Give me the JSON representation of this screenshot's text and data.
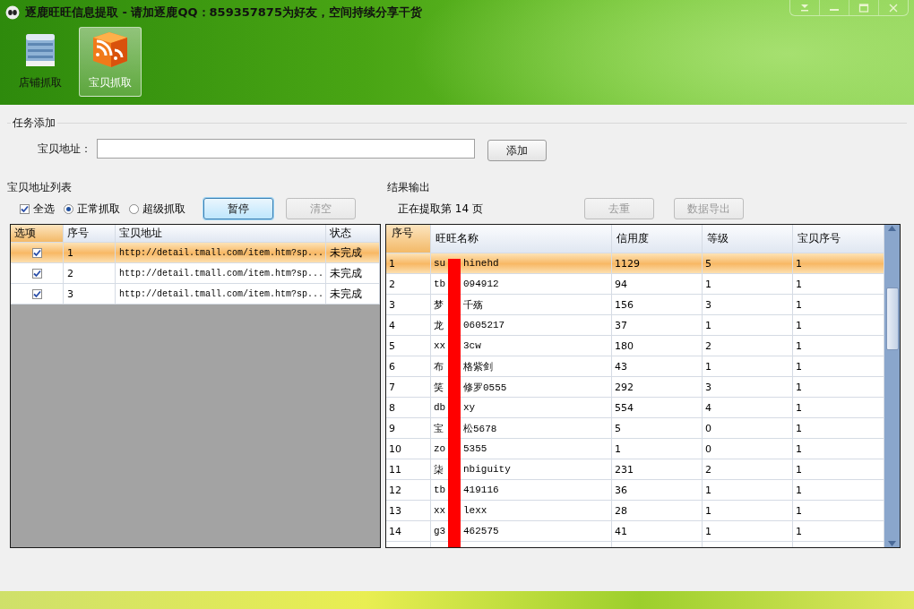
{
  "window": {
    "title": "逐鹿旺旺信息提取 - 请加逐鹿QQ：859357875为好友，空间持续分享干货"
  },
  "toolbar": [
    {
      "label": "店铺抓取",
      "kind": "building",
      "selected": false
    },
    {
      "label": "宝贝抓取",
      "kind": "feed",
      "selected": true
    }
  ],
  "task": {
    "legend": "任务添加",
    "field_label": "宝贝地址：",
    "add_button": "添加"
  },
  "url_list": {
    "legend": "宝贝地址列表",
    "select_all": {
      "label": "全选",
      "checked": true
    },
    "modes": [
      {
        "label": "正常抓取",
        "selected": true
      },
      {
        "label": "超级抓取",
        "selected": false
      }
    ],
    "buttons": [
      {
        "label": "暂停",
        "disabled": false
      },
      {
        "label": "清空",
        "disabled": true
      }
    ],
    "columns": [
      {
        "label": "选项",
        "sorted": true
      },
      {
        "label": "序号",
        "sorted": false
      },
      {
        "label": "宝贝地址",
        "sorted": false
      },
      {
        "label": "状态",
        "sorted": false
      }
    ],
    "rows": [
      {
        "checked": true,
        "index": "1",
        "url": "http://detail.tmall.com/item.htm?sp...",
        "status": "未完成",
        "selected": true
      },
      {
        "checked": true,
        "index": "2",
        "url": "http://detail.tmall.com/item.htm?sp...",
        "status": "未完成",
        "selected": false
      },
      {
        "checked": true,
        "index": "3",
        "url": "http://detail.tmall.com/item.htm?sp...",
        "status": "未完成",
        "selected": false
      }
    ]
  },
  "results": {
    "legend": "结果输出",
    "progress": "正在提取第 14 页",
    "buttons": [
      {
        "label": "去重",
        "disabled": true
      },
      {
        "label": "数据导出",
        "disabled": true
      }
    ],
    "columns": [
      {
        "label": "序号",
        "sorted": true
      },
      {
        "label": "旺旺名称",
        "sorted": false
      },
      {
        "label": "信用度",
        "sorted": false
      },
      {
        "label": "等级",
        "sorted": false
      },
      {
        "label": "宝贝序号",
        "sorted": false
      }
    ],
    "name_redacted": true,
    "rows": [
      {
        "index": "1",
        "name": [
          "su",
          "hinehd"
        ],
        "credit": "1129",
        "level": "5",
        "item": "1",
        "selected": true
      },
      {
        "index": "2",
        "name": [
          "tb",
          "094912"
        ],
        "credit": "94",
        "level": "1",
        "item": "1",
        "selected": false
      },
      {
        "index": "3",
        "name": [
          "梦",
          "千殇"
        ],
        "credit": "156",
        "level": "3",
        "item": "1",
        "selected": false
      },
      {
        "index": "4",
        "name": [
          "龙",
          "0605217"
        ],
        "credit": "37",
        "level": "1",
        "item": "1",
        "selected": false
      },
      {
        "index": "5",
        "name": [
          "xx",
          "3cw"
        ],
        "credit": "180",
        "level": "2",
        "item": "1",
        "selected": false
      },
      {
        "index": "6",
        "name": [
          "布",
          "格紫剑"
        ],
        "credit": "43",
        "level": "1",
        "item": "1",
        "selected": false
      },
      {
        "index": "7",
        "name": [
          "笑",
          "修罗0555"
        ],
        "credit": "292",
        "level": "3",
        "item": "1",
        "selected": false
      },
      {
        "index": "8",
        "name": [
          "db",
          "xy"
        ],
        "credit": "554",
        "level": "4",
        "item": "1",
        "selected": false
      },
      {
        "index": "9",
        "name": [
          "宝",
          "松5678"
        ],
        "credit": "5",
        "level": "0",
        "item": "1",
        "selected": false
      },
      {
        "index": "10",
        "name": [
          "zo",
          "5355"
        ],
        "credit": "1",
        "level": "0",
        "item": "1",
        "selected": false
      },
      {
        "index": "11",
        "name": [
          "柒",
          "nbiguity"
        ],
        "credit": "231",
        "level": "2",
        "item": "1",
        "selected": false
      },
      {
        "index": "12",
        "name": [
          "tb",
          "419116"
        ],
        "credit": "36",
        "level": "1",
        "item": "1",
        "selected": false
      },
      {
        "index": "13",
        "name": [
          "xx",
          "lexx"
        ],
        "credit": "28",
        "level": "1",
        "item": "1",
        "selected": false
      },
      {
        "index": "14",
        "name": [
          "g3",
          "462575"
        ],
        "credit": "41",
        "level": "1",
        "item": "1",
        "selected": false
      }
    ]
  }
}
